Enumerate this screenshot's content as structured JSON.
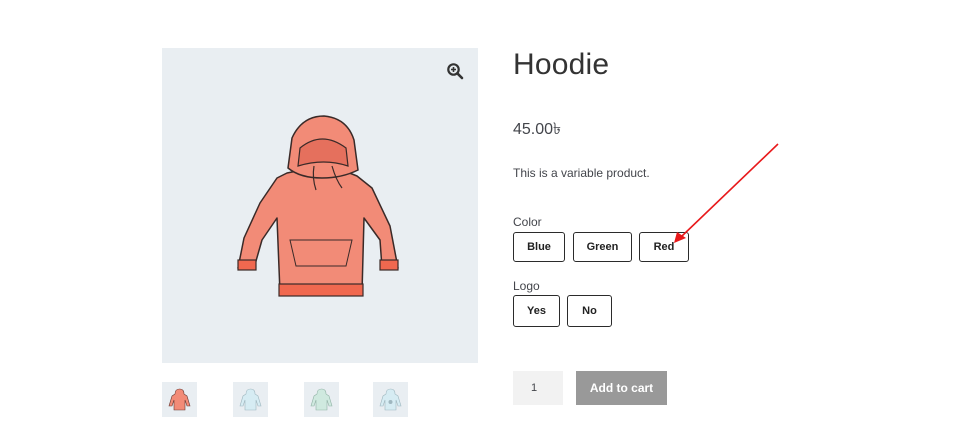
{
  "product": {
    "title": "Hoodie",
    "price": "45.00৳",
    "description": "This is a variable product."
  },
  "attributes": {
    "color": {
      "label": "Color",
      "options": [
        "Blue",
        "Green",
        "Red"
      ]
    },
    "logo": {
      "label": "Logo",
      "options": [
        "Yes",
        "No"
      ]
    }
  },
  "cart": {
    "quantity": "1",
    "add_to_cart_label": "Add to cart"
  },
  "gallery": {
    "zoom_icon": "zoom-in-icon",
    "thumbnails": [
      "hoodie-red",
      "hoodie-blue",
      "hoodie-green",
      "hoodie-blue-logo"
    ]
  },
  "colors": {
    "hoodie_main": "#f28b77",
    "hoodie_cuff": "#f0684f",
    "annotation_arrow": "#e8191b"
  }
}
